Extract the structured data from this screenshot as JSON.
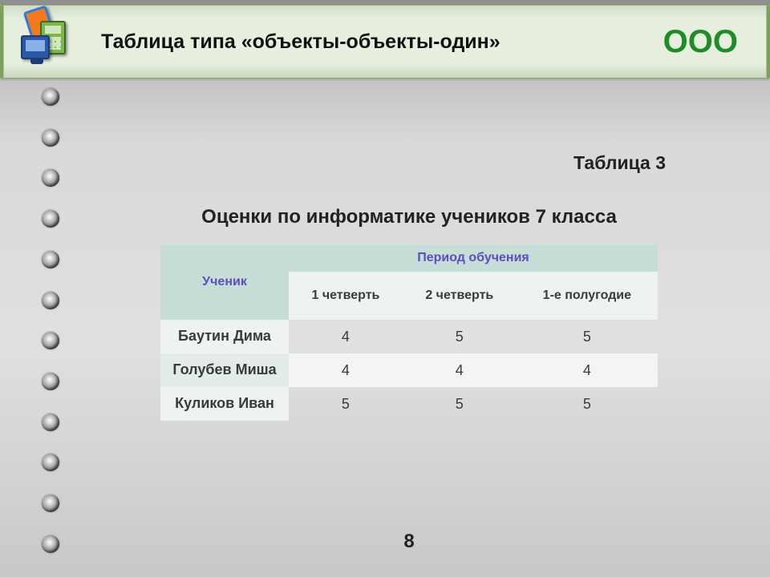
{
  "header": {
    "title": "Таблица типа «объекты-объекты-один»",
    "badge": "ООО",
    "icons": [
      "textbook-icon",
      "calculator-icon",
      "monitor-icon"
    ]
  },
  "table_number": "Таблица 3",
  "table_caption": "Оценки по информатике учеников 7 класса",
  "chart_data": {
    "type": "table",
    "col_header_group_left": "Ученик",
    "col_header_group_right": "Период обучения",
    "columns": [
      "1 четверть",
      "2 четверть",
      "1-е полугодие"
    ],
    "rows": [
      {
        "student": "Баутин Дима",
        "values": [
          4,
          5,
          5
        ]
      },
      {
        "student": "Голубев Миша",
        "values": [
          4,
          4,
          4
        ]
      },
      {
        "student": "Куликов Иван",
        "values": [
          5,
          5,
          5
        ]
      }
    ]
  },
  "page_number": "8",
  "colors": {
    "header_bg": "#e7efdf",
    "table_header_bg": "#c7ddd8",
    "table_header_text": "#5a4fbf",
    "accent_green": "#1e8c28"
  }
}
